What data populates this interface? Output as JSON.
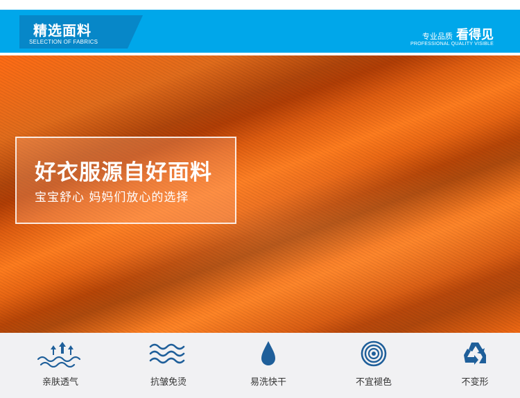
{
  "header": {
    "title": "精选面料",
    "subtitle": "SELECTION OF FABRICS",
    "right_small": "专业品质",
    "right_big": "看得见",
    "right_sub": "PROFESSIONAL QUALITY VISIBLE",
    "bar_color": "#00a7ea",
    "tag_color": "#0787c8"
  },
  "hero": {
    "title": "好衣服源自好面料",
    "subtitle": "宝宝舒心 妈妈们放心的选择",
    "fabric_color": "#ff6b14"
  },
  "features": [
    {
      "icon": "breathable-waves-icon",
      "label": "亲肤透气"
    },
    {
      "icon": "wrinkle-waves-icon",
      "label": "抗皱免烫"
    },
    {
      "icon": "water-drop-icon",
      "label": "易洗快干"
    },
    {
      "icon": "target-circles-icon",
      "label": "不宜褪色"
    },
    {
      "icon": "recycle-icon",
      "label": "不变形"
    }
  ],
  "icon_color": "#1f5f9a"
}
